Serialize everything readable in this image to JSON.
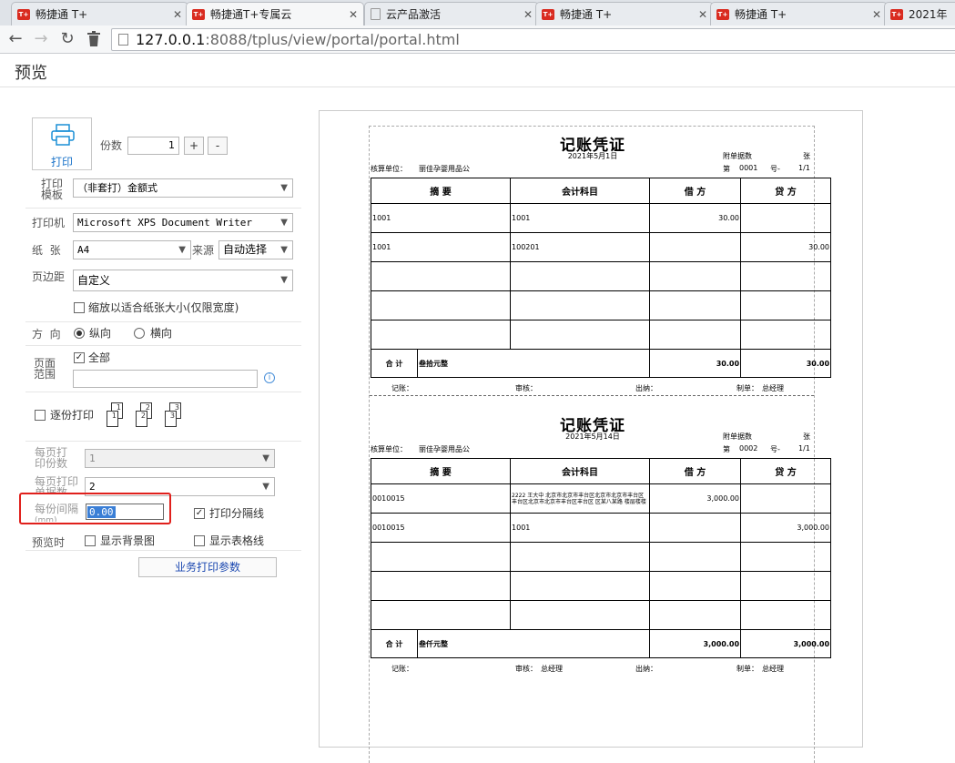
{
  "browser": {
    "tabs": [
      {
        "title": "畅捷通 T+",
        "favicon": "t-plus-favicon"
      },
      {
        "title": "畅捷通T+专属云",
        "favicon": "t-plus-favicon",
        "active": true
      },
      {
        "title": "云产品激活",
        "favicon": "doc-favicon"
      },
      {
        "title": "畅捷通 T+",
        "favicon": "t-plus-favicon"
      },
      {
        "title": "畅捷通 T+",
        "favicon": "t-plus-favicon"
      },
      {
        "title": "2021年",
        "favicon": "t-plus-favicon"
      }
    ],
    "favicon_text": "T+",
    "url_host": "127.0.0.1",
    "url_rest": ":8088/tplus/view/portal/portal.html"
  },
  "app": {
    "title": "预览"
  },
  "settings": {
    "print_label": "打印",
    "copies_label": "份数",
    "copies_value": "1",
    "plus": "+",
    "minus": "-",
    "template_label_1": "打印",
    "template_label_2": "模板",
    "template_value": "（非套打）金额式",
    "printer_label": "打印机",
    "printer_value": "Microsoft XPS Document Writer",
    "paper_label": "纸  张",
    "paper_value": "A4",
    "source_label": "来源",
    "source_value": "自动选择",
    "margin_label": "页边距",
    "margin_value": "自定义",
    "fit_label": "缩放以适合纸张大小(仅限宽度)",
    "orientation_label": "方  向",
    "portrait_label": "纵向",
    "landscape_label": "横向",
    "range_label_1": "页面",
    "range_label_2": "范围",
    "all_label": "全部",
    "range_value": "",
    "collate_label": "逐份打印",
    "collate_pages": [
      "1",
      "2",
      "3"
    ],
    "per_page_copies_label_1": "每页打",
    "per_page_copies_label_2": "印份数",
    "per_page_copies_value": "1",
    "per_page_docs_label_1": "每页打印",
    "per_page_docs_label_2": "单据数",
    "per_page_docs_value": "2",
    "interval_label_1": "每份间隔",
    "interval_label_2": "(mm)",
    "interval_value": "0.00",
    "print_separator_label": "打印分隔线",
    "preview_label": "预览时",
    "show_bg_label": "显示背景图",
    "show_grid_label": "显示表格线",
    "biz_params_button": "业务打印参数"
  },
  "preview": {
    "headers": [
      "摘  要",
      "会计科目",
      "借  方",
      "贷  方"
    ],
    "common": {
      "title": "记账凭证",
      "attach_label": "附单据数",
      "zhang": "张",
      "unit_label": "核算单位：",
      "unit_value": "丽佳孕婴用品公",
      "no_label": "第",
      "hao": "号-",
      "page": "1/1",
      "total_label": "合  计",
      "sign_jizhang": "记账：",
      "sign_shenhe": "审核：",
      "sign_chuna": "出纳：",
      "sign_zhidan": "制单：",
      "maker": "总经理"
    },
    "vouchers": [
      {
        "date": "2021年5月1日",
        "number": "0001",
        "rows": [
          {
            "summary": "1001",
            "account": "1001",
            "debit": "30.00",
            "credit": ""
          },
          {
            "summary": "1001",
            "account": "100201",
            "debit": "",
            "credit": "30.00"
          },
          {
            "summary": "",
            "account": "",
            "debit": "",
            "credit": ""
          },
          {
            "summary": "",
            "account": "",
            "debit": "",
            "credit": ""
          },
          {
            "summary": "",
            "account": "",
            "debit": "",
            "credit": ""
          }
        ],
        "total_words": "叁拾元整",
        "total_debit": "30.00",
        "total_credit": "30.00",
        "auditor": ""
      },
      {
        "date": "2021年5月14日",
        "number": "0002",
        "rows": [
          {
            "summary": "0010015",
            "account": "2222 王大中 北京市北京市丰台区北京市北京市丰台区丰台区北京市北京市丰台区丰台区 区某八某路 楼层楼楼",
            "debit": "3,000.00",
            "credit": ""
          },
          {
            "summary": "0010015",
            "account": "1001",
            "debit": "",
            "credit": "3,000.00"
          },
          {
            "summary": "",
            "account": "",
            "debit": "",
            "credit": ""
          },
          {
            "summary": "",
            "account": "",
            "debit": "",
            "credit": ""
          },
          {
            "summary": "",
            "account": "",
            "debit": "",
            "credit": ""
          }
        ],
        "total_words": "叁仟元整",
        "total_debit": "3,000.00",
        "total_credit": "3,000.00",
        "auditor": "总经理"
      }
    ]
  }
}
